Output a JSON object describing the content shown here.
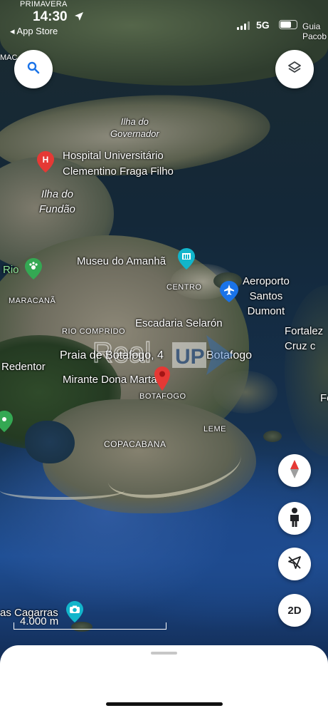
{
  "status_bar": {
    "carrier_top": "PRIMAVERA",
    "time": "14:30",
    "back_app": "◂ App Store",
    "network": "5G"
  },
  "corner_labels": {
    "top_right": "Guia\nPacob",
    "top_left": "MAC"
  },
  "map_labels": {
    "ilha_governador": "Ilha do\nGovernador",
    "hospital": "Hospital Universitário\nClementino Fraga Filho",
    "ilha_fundao": "Ilha do\nFundão",
    "museu": "Museu do Amanhã",
    "rio": "Rio",
    "maracana": "MARACANÃ",
    "centro": "CENTRO",
    "aeroporto": "Aeroporto\nSantos\nDumont",
    "fortaleza": "Fortalez\nCruz c",
    "escadaria": "Escadaria Selarón",
    "rio_comprido": "RIO COMPRIDO",
    "praia_botafogo": "Praia de Botafogo, 4",
    "botafogo_right": "Botafogo",
    "redentor": "Redentor",
    "mirante": "Mirante Dona Marta",
    "botafogo": "BOTAFOGO",
    "leme": "LEME",
    "copacabana": "COPACABANA",
    "cagarras": "as Cagarras",
    "f_right": "Fo"
  },
  "watermark_text": "Real UP",
  "controls": {
    "search_icon": "search-icon",
    "layers_icon": "layers-icon",
    "compass_icon": "compass-icon",
    "streetview_icon": "pegman-icon",
    "nav_off_icon": "navigation-off-icon",
    "view_mode": "2D"
  },
  "scale": {
    "label": "4.000 m"
  },
  "colors": {
    "pin_red": "#e53935",
    "poi_teal": "#12b5cb",
    "poi_green": "#34a853",
    "airport_blue": "#1a73e8"
  }
}
